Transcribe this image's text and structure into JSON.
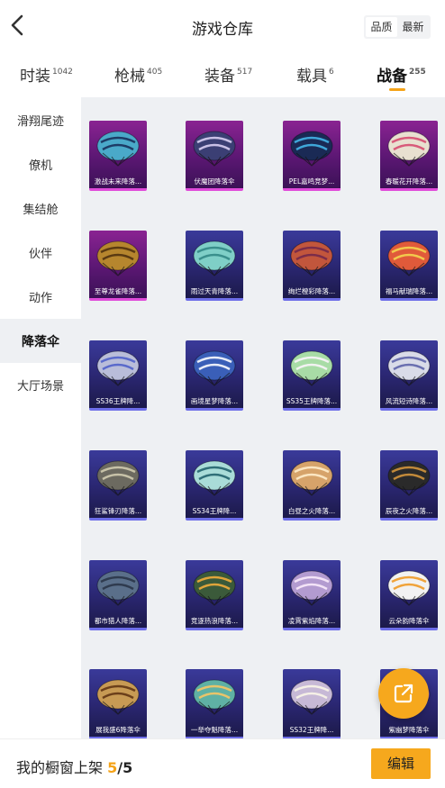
{
  "header": {
    "title": "游戏仓库",
    "sort_options": [
      "品质",
      "最新"
    ],
    "active_sort": "品质"
  },
  "tabs": [
    {
      "label": "时装",
      "count": "1042"
    },
    {
      "label": "枪械",
      "count": "405"
    },
    {
      "label": "装备",
      "count": "517"
    },
    {
      "label": "载具",
      "count": "6"
    },
    {
      "label": "战备",
      "count": "255",
      "active": true
    }
  ],
  "sidebar": {
    "items": [
      "滑翔尾迹",
      "僚机",
      "集结舱",
      "伙伴",
      "动作",
      "降落伞",
      "大厅场景"
    ],
    "active": "降落伞"
  },
  "items": [
    {
      "name": "激战未来降落...",
      "rarity": "purple",
      "color": "#4aa9c9",
      "accent": "#1d3c66"
    },
    {
      "name": "伏魔团降落伞",
      "rarity": "purple",
      "color": "#3b3f74",
      "accent": "#c9c0e6"
    },
    {
      "name": "PEL嘉鸣竞梦...",
      "rarity": "purple",
      "color": "#1a2a55",
      "accent": "#3fa6d9"
    },
    {
      "name": "春暖花开降落...",
      "rarity": "purple",
      "color": "#e8e0d0",
      "accent": "#d85a7a"
    },
    {
      "name": "至尊龙雀降落...",
      "rarity": "purple",
      "color": "#b6862e",
      "accent": "#5a3a12"
    },
    {
      "name": "雨过天青降落...",
      "rarity": "blue",
      "color": "#7fcfc7",
      "accent": "#3a8f8c"
    },
    {
      "name": "绚烂橙彩降落...",
      "rarity": "blue",
      "color": "#c2563c",
      "accent": "#7b2d4a"
    },
    {
      "name": "福马献瑞降落...",
      "rarity": "blue",
      "color": "#e05a3a",
      "accent": "#f2c94c"
    },
    {
      "name": "SS36王牌降...",
      "rarity": "blue",
      "color": "#b9bdd9",
      "accent": "#5a6acb"
    },
    {
      "name": "画境星梦降落...",
      "rarity": "blue",
      "color": "#3a5fb8",
      "accent": "#e8ecf8"
    },
    {
      "name": "SS35王牌降落...",
      "rarity": "blue",
      "color": "#a8dca6",
      "accent": "#f2f2f2"
    },
    {
      "name": "风流短诗降落...",
      "rarity": "blue",
      "color": "#d9dbe8",
      "accent": "#6a6fb0"
    },
    {
      "name": "狂鲨锋刃降落...",
      "rarity": "blue",
      "color": "#6c6a60",
      "accent": "#c7c2a8"
    },
    {
      "name": "SS34王牌降...",
      "rarity": "blue",
      "color": "#a9dcd8",
      "accent": "#2f6f78"
    },
    {
      "name": "白昼之火降落...",
      "rarity": "blue",
      "color": "#d6a36a",
      "accent": "#fbe6c2"
    },
    {
      "name": "辰夜之火降落...",
      "rarity": "blue",
      "color": "#2a2a2a",
      "accent": "#c28a3a"
    },
    {
      "name": "都市猎人降落...",
      "rarity": "blue",
      "color": "#5a6f8a",
      "accent": "#2f3b4f"
    },
    {
      "name": "竞逐热浪降落...",
      "rarity": "blue",
      "color": "#3b5a3a",
      "accent": "#e0a43a"
    },
    {
      "name": "凌霄紫焰降落...",
      "rarity": "blue",
      "color": "#b39bd0",
      "accent": "#f3e3f7"
    },
    {
      "name": "云朵韵降落伞",
      "rarity": "blue",
      "color": "#f2f2f2",
      "accent": "#f0a33a"
    },
    {
      "name": "展我盛6降落伞",
      "rarity": "blue",
      "color": "#c79a54",
      "accent": "#6b3f1a"
    },
    {
      "name": "一举夺魁降落...",
      "rarity": "blue",
      "color": "#5fb1a4",
      "accent": "#e9c46a"
    },
    {
      "name": "SS32王牌降...",
      "rarity": "blue",
      "color": "#c7b9d6",
      "accent": "#f5f0e6"
    },
    {
      "name": "紫幽梦降落伞",
      "rarity": "blue",
      "color": "#7b4fb8",
      "accent": "#d9c3f0"
    }
  ],
  "bottom": {
    "showcase_label": "我的橱窗上架",
    "current": "5",
    "separator": "/",
    "total": "5",
    "edit_label": "编辑"
  }
}
